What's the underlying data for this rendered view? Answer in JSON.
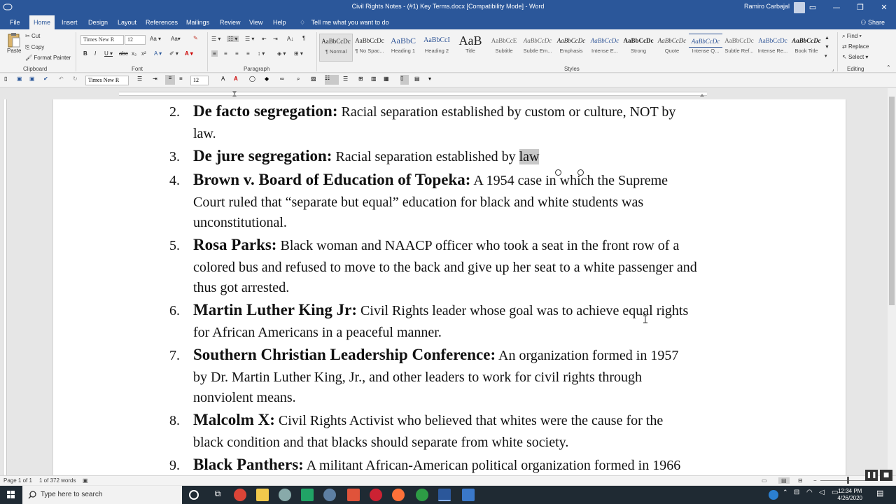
{
  "window": {
    "title": "Civil Rights Notes - (#1) Key Terms.docx [Compatibility Mode] - Word",
    "user": "Ramiro Carbajal",
    "minimize": "—",
    "restore": "❐",
    "close": "✕"
  },
  "tabs": [
    "File",
    "Home",
    "Insert",
    "Design",
    "Layout",
    "References",
    "Mailings",
    "Review",
    "View",
    "Help"
  ],
  "tell_me": "Tell me what you want to do",
  "share": "Share",
  "ribbon": {
    "clipboard": {
      "paste": "Paste",
      "cut": "Cut",
      "copy": "Copy",
      "format_painter": "Format Painter",
      "label": "Clipboard"
    },
    "font": {
      "name": "Times New R",
      "size": "12",
      "label": "Font"
    },
    "paragraph": {
      "label": "Paragraph"
    },
    "styles": {
      "label": "Styles",
      "items": [
        {
          "sample": "AaBbCcDc",
          "name": "¶ Normal"
        },
        {
          "sample": "AaBbCcDc",
          "name": "¶ No Spac..."
        },
        {
          "sample": "AaBbC",
          "name": "Heading 1"
        },
        {
          "sample": "AaBbCcI",
          "name": "Heading 2"
        },
        {
          "sample": "AaB",
          "name": "Title"
        },
        {
          "sample": "AaBbCcE",
          "name": "Subtitle"
        },
        {
          "sample": "AaBbCcDc",
          "name": "Subtle Em..."
        },
        {
          "sample": "AaBbCcDc",
          "name": "Emphasis"
        },
        {
          "sample": "AaBbCcDc",
          "name": "Intense E..."
        },
        {
          "sample": "AaBbCcDc",
          "name": "Strong"
        },
        {
          "sample": "AaBbCcDc",
          "name": "Quote"
        },
        {
          "sample": "AaBbCcDc",
          "name": "Intense Q..."
        },
        {
          "sample": "AaBbCcDc",
          "name": "Subtle Ref..."
        },
        {
          "sample": "AaBbCcDc",
          "name": "Intense Re..."
        },
        {
          "sample": "AaBbCcDc",
          "name": "Book Title"
        }
      ]
    },
    "editing": {
      "find": "Find",
      "replace": "Replace",
      "select": "Select",
      "label": "Editing"
    }
  },
  "toolbar2": {
    "font": "Times New R",
    "size": "12"
  },
  "document": {
    "entries": [
      {
        "num": "2.",
        "term": "De facto segregation:",
        "lines": [
          " Racial separation established by custom or culture, NOT by",
          "law."
        ]
      },
      {
        "num": "3.",
        "term": "De jure segregation:",
        "lines": [
          " Racial separation established by ",
          "law"
        ]
      },
      {
        "num": "4.",
        "term": "Brown v. Board of Education of Topeka:",
        "lines": [
          " A 1954 case in which the Supreme",
          "Court ruled that “separate but equal” education for black and white students was",
          "unconstitutional."
        ]
      },
      {
        "num": "5.",
        "term": "Rosa Parks:",
        "lines": [
          " Black woman and NAACP officer who took a seat in the front row of a",
          "colored bus and refused to move to the back and give up her seat to a white passenger and",
          "thus got arrested."
        ]
      },
      {
        "num": "6.",
        "term": "Martin Luther King Jr:",
        "lines": [
          " Civil Rights leader whose goal was to achieve equal rights",
          "for African Americans in a peaceful manner."
        ]
      },
      {
        "num": "7.",
        "term": "Southern Christian Leadership Conference:",
        "lines": [
          " An organization formed in 1957",
          "by Dr. Martin Luther King, Jr., and other leaders to work for civil rights through",
          "nonviolent means."
        ]
      },
      {
        "num": "8.",
        "term": "Malcolm X:",
        "lines": [
          " Civil Rights Activist who believed that whites were the cause for the",
          "black condition and that blacks should separate from white society."
        ]
      },
      {
        "num": "9.",
        "term": "Black Panthers:",
        "lines": [
          " A militant African-American political organization formed in 1966"
        ]
      }
    ]
  },
  "status": {
    "page": "Page 1 of 1",
    "words": "1 of 372 words"
  },
  "taskbar": {
    "search_placeholder": "Type here to search",
    "time": "12:34 PM",
    "date": "4/26/2020"
  },
  "colors": {
    "word_blue": "#2b579a",
    "selection": "#c8c8c8",
    "taskbar": "#1f2a33"
  }
}
